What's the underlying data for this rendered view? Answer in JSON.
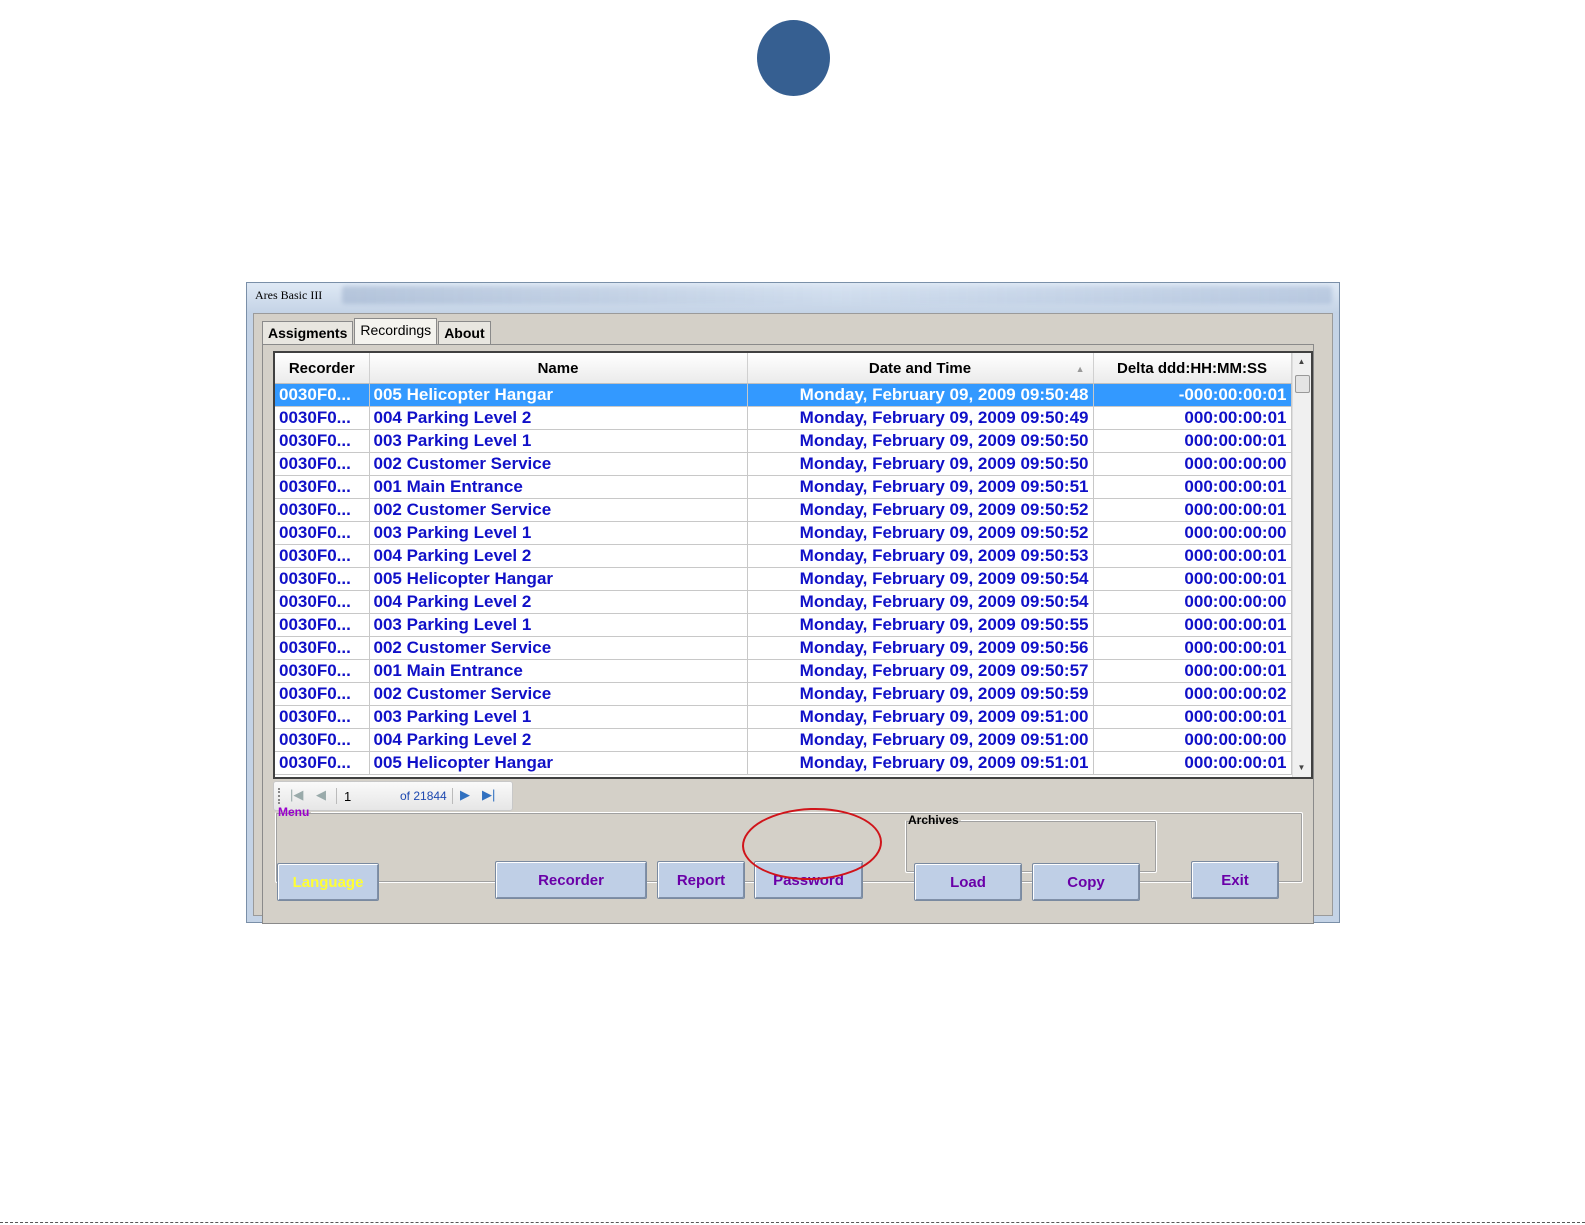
{
  "window": {
    "title": "Ares Basic III"
  },
  "tabs": [
    {
      "label": "Assigments",
      "active": false
    },
    {
      "label": "Recordings",
      "active": true
    },
    {
      "label": "About",
      "active": false
    }
  ],
  "grid": {
    "columns": [
      "Recorder",
      "Name",
      "Date and Time",
      "Delta ddd:HH:MM:SS"
    ],
    "sorted_column": "Date and Time",
    "selected_row": 0,
    "rows": [
      [
        "0030F0...",
        "005 Helicopter Hangar",
        "Monday, February 09, 2009 09:50:48",
        "-000:00:00:01"
      ],
      [
        "0030F0...",
        "004 Parking Level 2",
        "Monday, February 09, 2009 09:50:49",
        "000:00:00:01"
      ],
      [
        "0030F0...",
        "003 Parking Level 1",
        "Monday, February 09, 2009 09:50:50",
        "000:00:00:01"
      ],
      [
        "0030F0...",
        "002 Customer Service",
        "Monday, February 09, 2009 09:50:50",
        "000:00:00:00"
      ],
      [
        "0030F0...",
        "001 Main Entrance",
        "Monday, February 09, 2009 09:50:51",
        "000:00:00:01"
      ],
      [
        "0030F0...",
        "002 Customer Service",
        "Monday, February 09, 2009 09:50:52",
        "000:00:00:01"
      ],
      [
        "0030F0...",
        "003 Parking Level 1",
        "Monday, February 09, 2009 09:50:52",
        "000:00:00:00"
      ],
      [
        "0030F0...",
        "004 Parking Level 2",
        "Monday, February 09, 2009 09:50:53",
        "000:00:00:01"
      ],
      [
        "0030F0...",
        "005 Helicopter Hangar",
        "Monday, February 09, 2009 09:50:54",
        "000:00:00:01"
      ],
      [
        "0030F0...",
        "004 Parking Level 2",
        "Monday, February 09, 2009 09:50:54",
        "000:00:00:00"
      ],
      [
        "0030F0...",
        "003 Parking Level 1",
        "Monday, February 09, 2009 09:50:55",
        "000:00:00:01"
      ],
      [
        "0030F0...",
        "002 Customer Service",
        "Monday, February 09, 2009 09:50:56",
        "000:00:00:01"
      ],
      [
        "0030F0...",
        "001 Main Entrance",
        "Monday, February 09, 2009 09:50:57",
        "000:00:00:01"
      ],
      [
        "0030F0...",
        "002 Customer Service",
        "Monday, February 09, 2009 09:50:59",
        "000:00:00:02"
      ],
      [
        "0030F0...",
        "003 Parking Level 1",
        "Monday, February 09, 2009 09:51:00",
        "000:00:00:01"
      ],
      [
        "0030F0...",
        "004 Parking Level 2",
        "Monday, February 09, 2009 09:51:00",
        "000:00:00:00"
      ],
      [
        "0030F0...",
        "005 Helicopter Hangar",
        "Monday, February 09, 2009 09:51:01",
        "000:00:00:01"
      ]
    ]
  },
  "navigator": {
    "position": "1",
    "count_label": "of 21844",
    "icons": [
      "first-page-icon",
      "prev-page-icon",
      "next-page-icon",
      "last-page-icon"
    ]
  },
  "menu": {
    "legend": "Menu",
    "language_label": "Language",
    "recorder_label": "Recorder",
    "report_label": "Report",
    "password_label": "Password",
    "exit_label": "Exit"
  },
  "archives": {
    "legend": "Archives",
    "load_label": "Load",
    "copy_label": "Copy"
  },
  "colors": {
    "accent_dot": "#365f91",
    "row_text": "#1010c8",
    "selection": "#3399ff",
    "button_text": "#6a00a8",
    "language_text": "#ffff33",
    "highlight_ring": "#d0141a"
  }
}
